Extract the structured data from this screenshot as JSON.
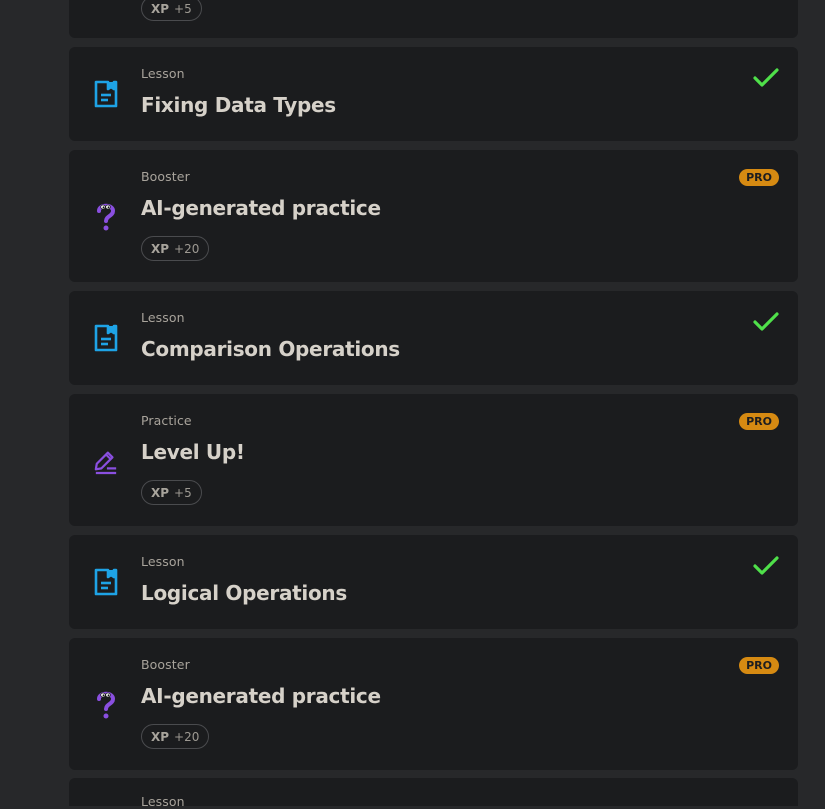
{
  "colors": {
    "background": "#27282a",
    "card": "#1b1c1e",
    "lesson_icon": "#1ea3e6",
    "booster_icon": "#8a4fe0",
    "practice_icon": "#8a4fe0",
    "check": "#4fe04a",
    "pro_badge": "#d68a12"
  },
  "items": [
    {
      "xp_label": "XP",
      "xp_value": "+5"
    },
    {
      "kind": "Lesson",
      "title": "Fixing Data Types",
      "icon": "lesson-doc-icon",
      "completed": true
    },
    {
      "kind": "Booster",
      "title": "AI-generated practice",
      "icon": "question-mark-icon",
      "badge": "PRO",
      "xp_label": "XP",
      "xp_value": "+20"
    },
    {
      "kind": "Lesson",
      "title": "Comparison Operations",
      "icon": "lesson-doc-icon",
      "completed": true
    },
    {
      "kind": "Practice",
      "title": "Level Up!",
      "icon": "pencil-edit-icon",
      "badge": "PRO",
      "xp_label": "XP",
      "xp_value": "+5"
    },
    {
      "kind": "Lesson",
      "title": "Logical Operations",
      "icon": "lesson-doc-icon",
      "completed": true
    },
    {
      "kind": "Booster",
      "title": "AI-generated practice",
      "icon": "question-mark-icon",
      "badge": "PRO",
      "xp_label": "XP",
      "xp_value": "+20"
    },
    {
      "kind": "Lesson"
    }
  ]
}
